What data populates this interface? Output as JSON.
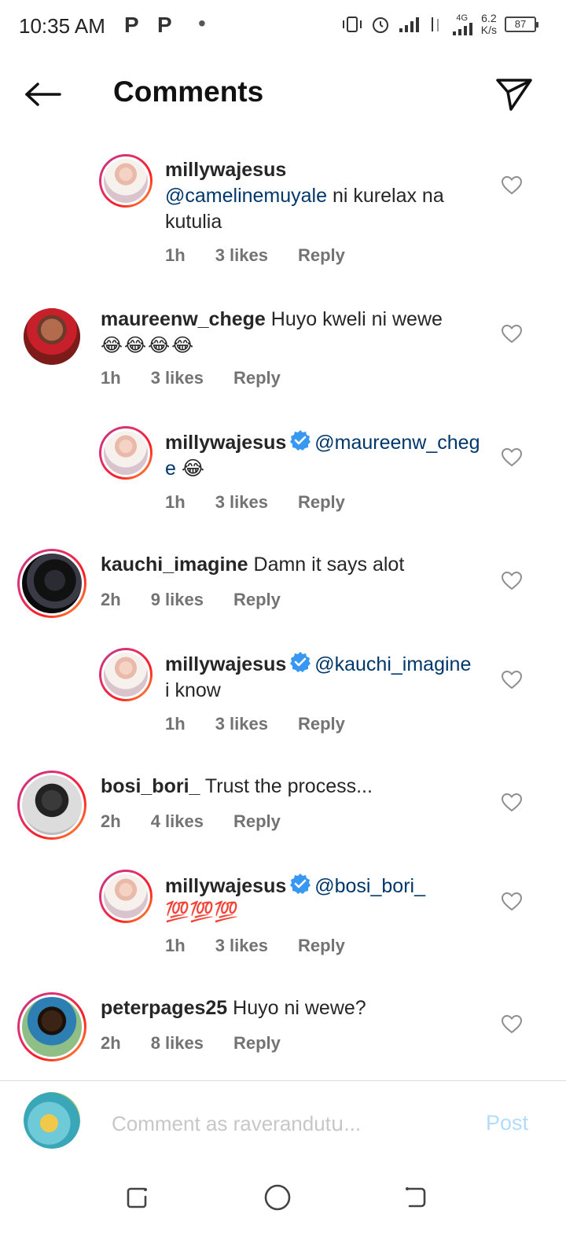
{
  "status": {
    "time": "10:35 AM",
    "notif_icons": [
      "P",
      "P",
      "•"
    ],
    "network": "4G",
    "speed_value": "6.2",
    "speed_unit": "K/s",
    "battery": "87"
  },
  "header": {
    "title": "Comments"
  },
  "comments": [
    {
      "username": "millywajesus",
      "verified": false,
      "mention": "@camelinemuyale",
      "text": " ni kurelax na kutulia",
      "time": "1h",
      "likes": "3 likes",
      "reply": "Reply"
    },
    {
      "username": "maureenw_chege",
      "verified": false,
      "mention": "",
      "text": " Huyo kweli ni wewe",
      "emoji": "😂😂😂😂",
      "time": "1h",
      "likes": "3 likes",
      "reply": "Reply"
    },
    {
      "username": "millywajesus",
      "verified": true,
      "mention": "@maureenw_chege",
      "text": "",
      "emoji": "😂",
      "time": "1h",
      "likes": "3 likes",
      "reply": "Reply"
    },
    {
      "username": "kauchi_imagine",
      "verified": false,
      "mention": "",
      "text": " Damn it says alot",
      "time": "2h",
      "likes": "9 likes",
      "reply": "Reply"
    },
    {
      "username": "millywajesus",
      "verified": true,
      "mention": "@kauchi_imagine",
      "text": " i know",
      "time": "1h",
      "likes": "3 likes",
      "reply": "Reply"
    },
    {
      "username": "bosi_bori_",
      "verified": false,
      "mention": "",
      "text": " Trust the process...",
      "time": "2h",
      "likes": "4 likes",
      "reply": "Reply"
    },
    {
      "username": "millywajesus",
      "verified": true,
      "mention": "@bosi_bori_",
      "text": "",
      "emoji": "💯💯💯",
      "time": "1h",
      "likes": "3 likes",
      "reply": "Reply"
    },
    {
      "username": "peterpages25",
      "verified": false,
      "mention": "",
      "text": " Huyo ni wewe?",
      "time": "2h",
      "likes": "8 likes",
      "reply": "Reply"
    }
  ],
  "composer": {
    "placeholder": "Comment as raverandutս...",
    "post_label": "Post"
  },
  "colors": {
    "mention": "#00376b",
    "meta": "#737373",
    "verified": "#3897f0",
    "post_disabled": "#b3dbff"
  }
}
